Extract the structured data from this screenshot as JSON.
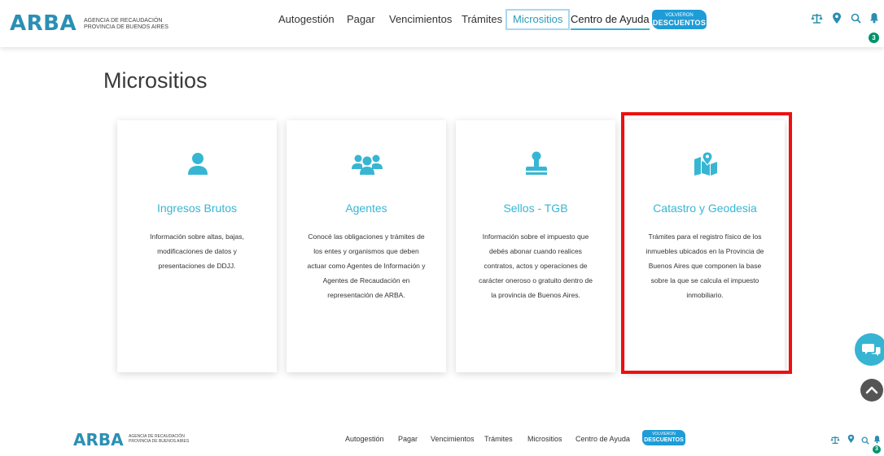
{
  "header": {
    "logo": "ARBA",
    "logo_sub_1": "AGENCIA DE RECAUDACIÓN",
    "logo_sub_2": "PROVINCIA DE BUENOS AIRES",
    "nav": [
      "Autogestión",
      "Pagar",
      "Vencimientos",
      "Trámites",
      "Micrositios",
      "Centro de Ayuda"
    ],
    "promo_line1": "VOLVIERON",
    "promo_line2": "DESCUENTOS",
    "badge": "3",
    "icons": [
      "scale-icon",
      "location-pin-icon",
      "search-icon",
      "notification-bell-icon"
    ]
  },
  "main": {
    "title": "Micrositios",
    "cards": [
      {
        "icon": "user-icon",
        "title": "Ingresos Brutos",
        "description": "Información sobre altas, bajas, modificaciones de datos y presentaciones de DDJJ."
      },
      {
        "icon": "group-users-icon",
        "title": "Agentes",
        "description": "Conocé las obligaciones y trámites de los entes y organismos que deben actuar como Agentes de Información y Agentes de Recaudación en representación de ARBA."
      },
      {
        "icon": "stamp-icon",
        "title": "Sellos - TGB",
        "description": "Información sobre el impuesto que debés abonar cuando realices contratos, actos y operaciones de carácter oneroso o gratuito dentro de la provincia de Buenos Aires."
      },
      {
        "icon": "map-location-icon",
        "title": "Catastro y Geodesia",
        "description": "Trámites para el registro físico de los inmuebles ubicados en la Provincia de Buenos Aires que componen la base sobre la que se calcula el impuesto inmobiliario."
      }
    ]
  },
  "footer": {
    "logo": "ARBA",
    "logo_sub_1": "AGENCIA DE RECAUDACIÓN",
    "logo_sub_2": "PROVINCIA DE BUENOS AIRES",
    "nav": [
      "Autogestión",
      "Pagar",
      "Vencimientos",
      "Trámites",
      "Micrositios",
      "Centro de Ayuda"
    ],
    "promo_line1": "VOLVIERON",
    "promo_line2": "DESCUENTOS",
    "badge": "3"
  },
  "colors": {
    "brand": "#2b8fb4",
    "accent": "#37b6d3",
    "highlight": "#ee0f0f",
    "badge": "#00936a"
  }
}
